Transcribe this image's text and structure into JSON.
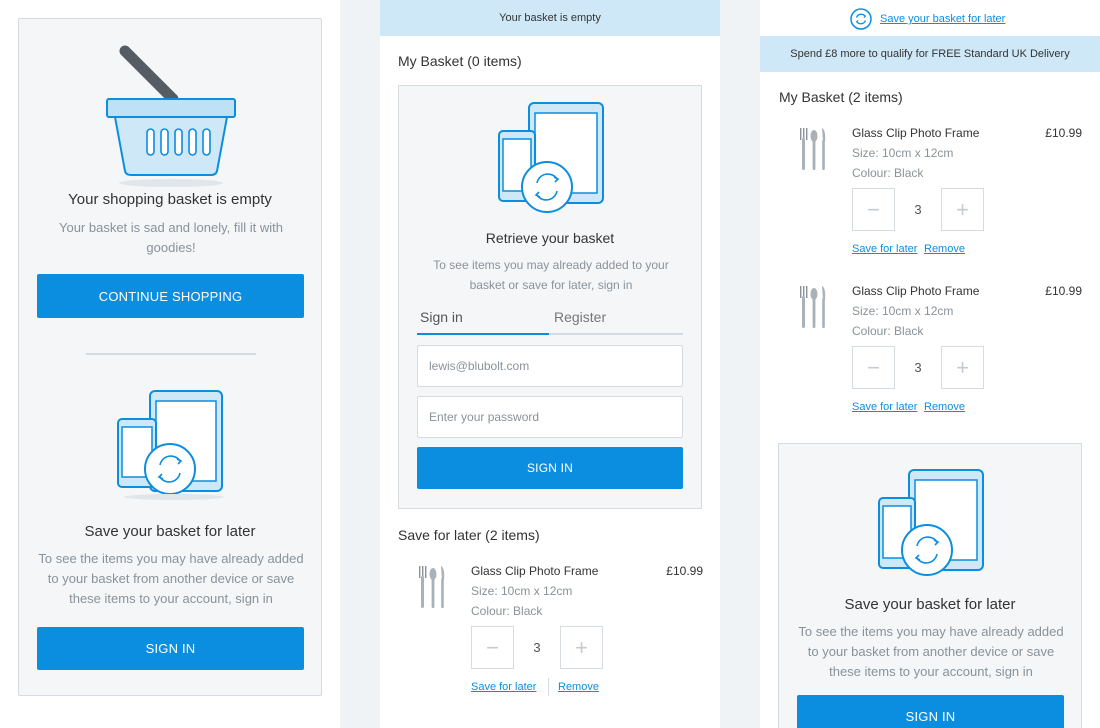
{
  "colors": {
    "accent": "#0c8ee0",
    "banner": "#cfe8f8",
    "panel": "#f4f6f8"
  },
  "panel1": {
    "basket_icon": "shopping-basket-icon",
    "title": "Your shopping basket is empty",
    "subtitle": "Your basket is sad and lonely, fill it with goodies!",
    "continue_button": "CONTINUE SHOPPING",
    "devices_icon": "devices-sync-icon",
    "save_title": "Save your basket for later",
    "save_text": "To see the items you may have already added to your basket from another device or save these items to your account, sign in",
    "sign_in_button": "SIGN IN"
  },
  "panel2": {
    "banner": "Your basket is empty",
    "heading": "My Basket (0 items)",
    "devices_icon": "devices-sync-icon",
    "retrieve_title": "Retrieve your basket",
    "retrieve_text": "To see items you may already added to your basket or save for later, sign in",
    "tabs": [
      {
        "label": "Sign in",
        "active": true
      },
      {
        "label": "Register",
        "active": false
      }
    ],
    "email_value": "lewis@blubolt.com",
    "password_placeholder": "Enter your password",
    "sign_in_button": "SIGN IN",
    "save_heading": "Save for later (2 items)",
    "item": {
      "icon": "cutlery-icon",
      "name": "Glass Clip Photo Frame",
      "price": "£10.99",
      "size": "Size: 10cm x 12cm",
      "colour": "Colour: Black",
      "minus": "−",
      "qty": "3",
      "plus": "+",
      "save_link": "Save for later",
      "remove_link": "Remove"
    }
  },
  "panel3": {
    "save_link": "Save your basket for later",
    "save_link_icon": "sync-icon",
    "banner": "Spend £8 more to qualify for FREE Standard UK Delivery",
    "heading": "My Basket (2 items)",
    "items": [
      {
        "icon": "cutlery-icon",
        "name": "Glass Clip Photo Frame",
        "price": "£10.99",
        "size": "Size: 10cm x 12cm",
        "colour": "Colour: Black",
        "minus": "−",
        "qty": "3",
        "plus": "+",
        "save_link": "Save for later",
        "remove_link": "Remove"
      },
      {
        "icon": "cutlery-icon",
        "name": "Glass Clip Photo Frame",
        "price": "£10.99",
        "size": "Size: 10cm x 12cm",
        "colour": "Colour: Black",
        "minus": "−",
        "qty": "3",
        "plus": "+",
        "save_link": "Save for later",
        "remove_link": "Remove"
      }
    ],
    "devices_icon": "devices-sync-icon",
    "save_title": "Save your basket for later",
    "save_text": "To see the items you may have already added to your basket from another device or save these items to your account, sign in",
    "sign_in_button": "SIGN IN"
  }
}
